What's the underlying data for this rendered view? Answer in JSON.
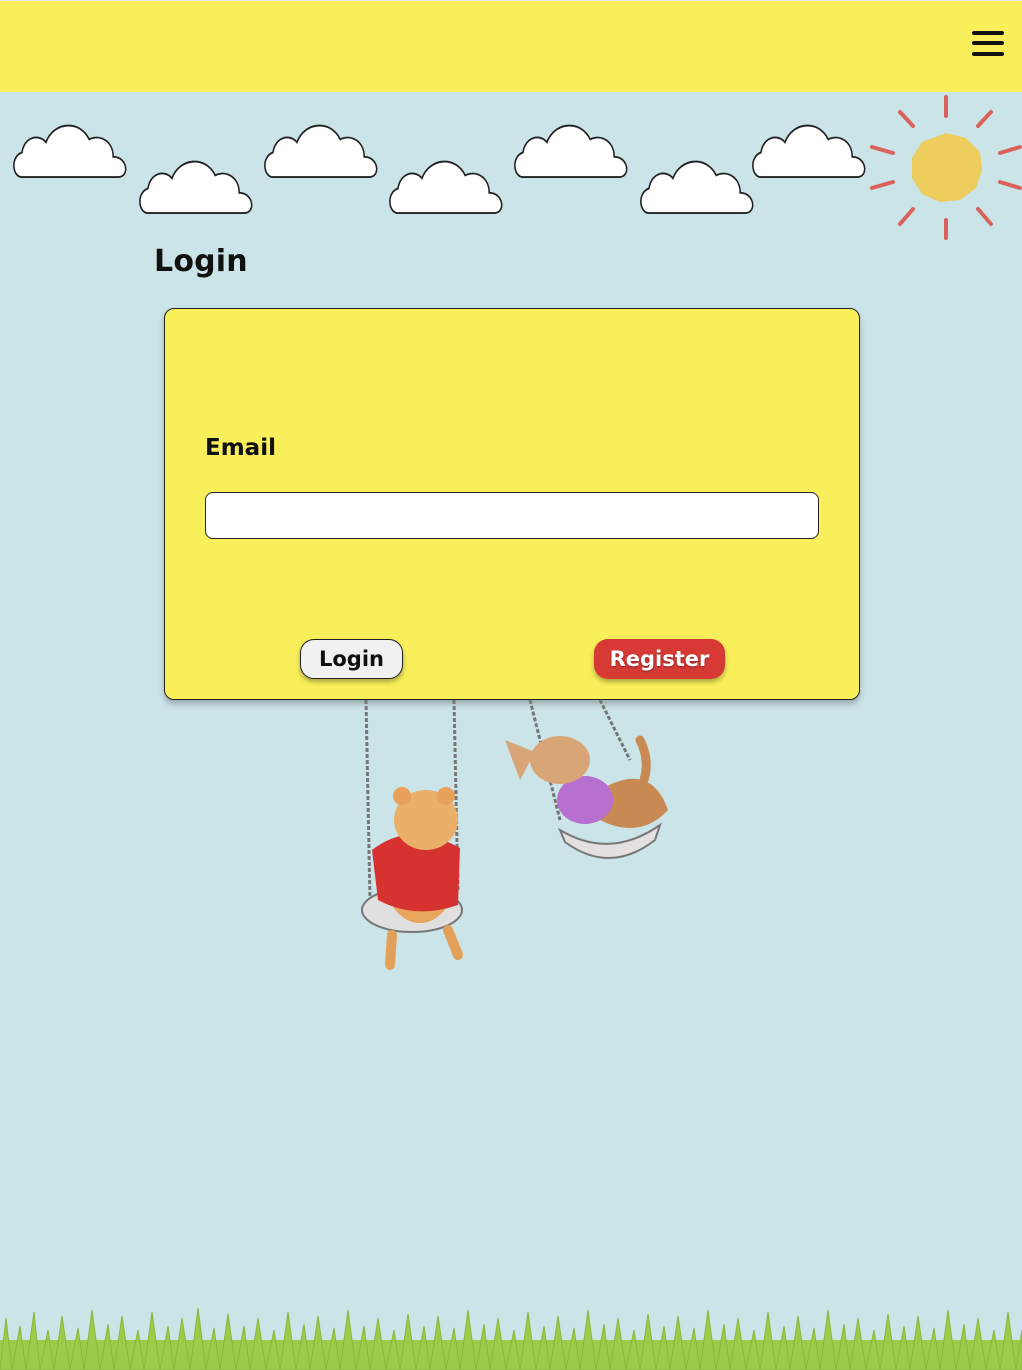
{
  "header": {
    "menu_icon": "hamburger-menu-icon"
  },
  "page": {
    "title": "Login"
  },
  "form": {
    "email_label": "Email",
    "email_value": "",
    "email_placeholder": "",
    "login_label": "Login",
    "register_label": "Register"
  },
  "colors": {
    "topbar": "#f8ef5a",
    "sky": "#cbe4e8",
    "card": "#f8ef5a",
    "register_button": "#d73a35",
    "sun": "#eccd5e",
    "sun_rays": "#d9625d",
    "grass": "#9ccb4a"
  },
  "decorations": {
    "clouds": "cloud-icon",
    "sun": "sun-icon",
    "illustration": "mice-on-swings",
    "ground": "grass"
  }
}
